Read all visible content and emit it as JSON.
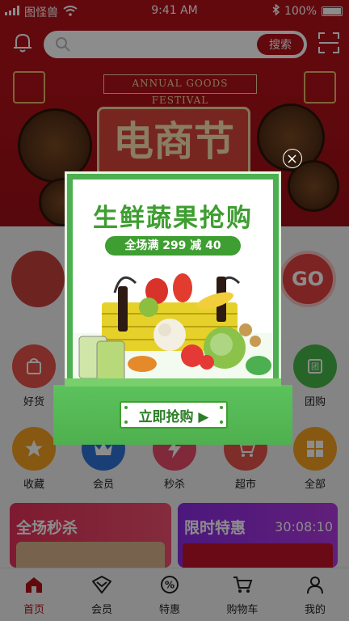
{
  "status": {
    "carrier": "图怪兽",
    "time": "9:41 AM",
    "battery": "100%"
  },
  "header": {
    "search_placeholder": "",
    "search_button": "搜索"
  },
  "banner": {
    "festival_label": "ANNUAL GOODS FESTIVAL",
    "title": "电商节"
  },
  "categories_row1": [
    {
      "label": "好货",
      "icon": "bag-icon",
      "color": "#e8524a"
    },
    {
      "label": "团购",
      "icon": "group-icon",
      "color": "#47b649"
    }
  ],
  "categories_row2": [
    {
      "label": "收藏",
      "icon": "star-icon",
      "color": "#f4a020"
    },
    {
      "label": "会员",
      "icon": "crown-icon",
      "color": "#2f74d8"
    },
    {
      "label": "秒杀",
      "icon": "bolt-icon",
      "color": "#e84c6a"
    },
    {
      "label": "超市",
      "icon": "cart-icon",
      "color": "#e8524a"
    },
    {
      "label": "全部",
      "icon": "grid-icon",
      "color": "#f4a020"
    }
  ],
  "promos": {
    "flash_title": "全场秒杀",
    "limited_title": "限时特惠",
    "countdown": "30:08:10"
  },
  "tabs": [
    {
      "label": "首页",
      "icon": "home-icon",
      "active": true
    },
    {
      "label": "会员",
      "icon": "vip-icon",
      "active": false
    },
    {
      "label": "特惠",
      "icon": "discount-icon",
      "active": false
    },
    {
      "label": "购物车",
      "icon": "cart-icon",
      "active": false
    },
    {
      "label": "我的",
      "icon": "profile-icon",
      "active": false
    }
  ],
  "popup": {
    "title": "生鲜蔬果抢购",
    "subtitle": "全场满 299 减 40",
    "button": "立即抢购 ▶"
  },
  "colors": {
    "brand_red": "#b3121a",
    "popup_green": "#4caf50"
  }
}
